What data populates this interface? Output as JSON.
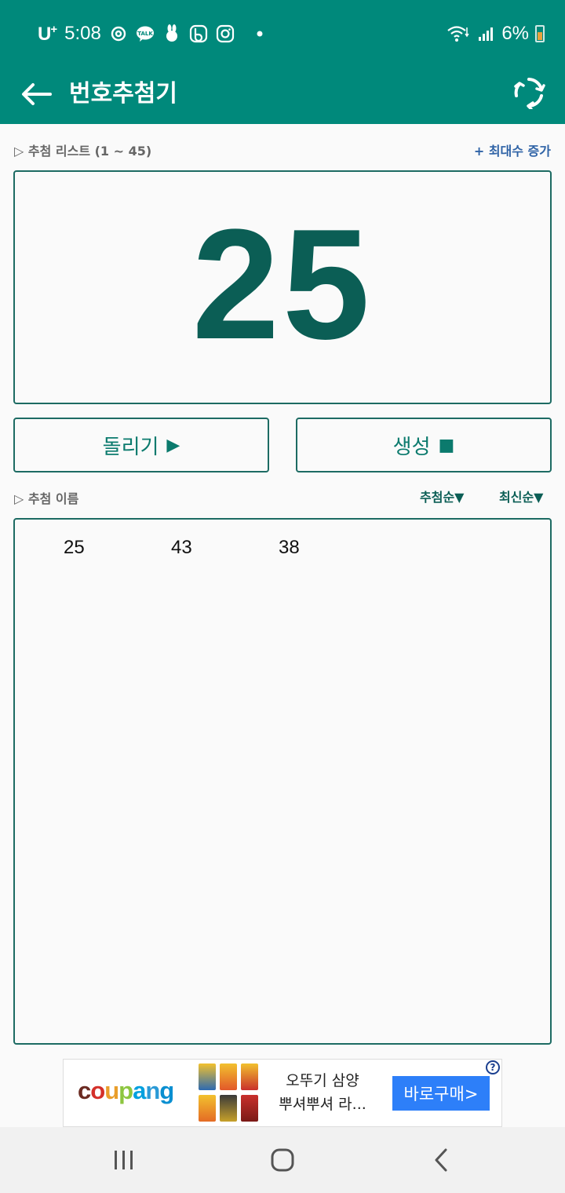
{
  "statusbar": {
    "carrier": "U",
    "carrier_sup": "+",
    "time": "5:08",
    "battery_text": "6%",
    "notification_icons": [
      "talk-icon",
      "rabbit-icon",
      "b-icon",
      "instagram-icon"
    ]
  },
  "appbar": {
    "title": "번호추첨기",
    "back_icon": "arrow-left-icon",
    "refresh_icon": "refresh-icon"
  },
  "draw_section": {
    "label": "▷ 추첨 리스트 (1 ~ 45)",
    "increase_max": "+ 최대수 증가",
    "current_number": "25"
  },
  "buttons": {
    "spin_label": "돌리기",
    "spin_glyph": "▶",
    "generate_label": "생성",
    "generate_glyph": "■"
  },
  "results_section": {
    "label": "▷ 추첨 이름",
    "sort_draw_order": "추첨순▼",
    "sort_latest": "최신순▼",
    "numbers": [
      "25",
      "43",
      "38"
    ]
  },
  "ad": {
    "brand": {
      "c": "c",
      "o1": "o",
      "u": "u",
      "p": "p",
      "a": "a",
      "n": "n",
      "g": "g"
    },
    "brand_colors": {
      "c": "#6b2b22",
      "o1": "#d4302a",
      "u": "#e99e2b",
      "p": "#8dc63f",
      "a": "#00a0df",
      "n": "#2b9ad6",
      "g": "#0a8fd1"
    },
    "product_line1": "오뚜기 삼양",
    "product_line2": "뿌셔뿌셔 라...",
    "cta": "바로구매>",
    "help": "?"
  },
  "colors": {
    "primary": "#00897b",
    "dark_green": "#0b5e55",
    "link_blue": "#2f63a6",
    "cta_blue": "#2d7ff9"
  }
}
